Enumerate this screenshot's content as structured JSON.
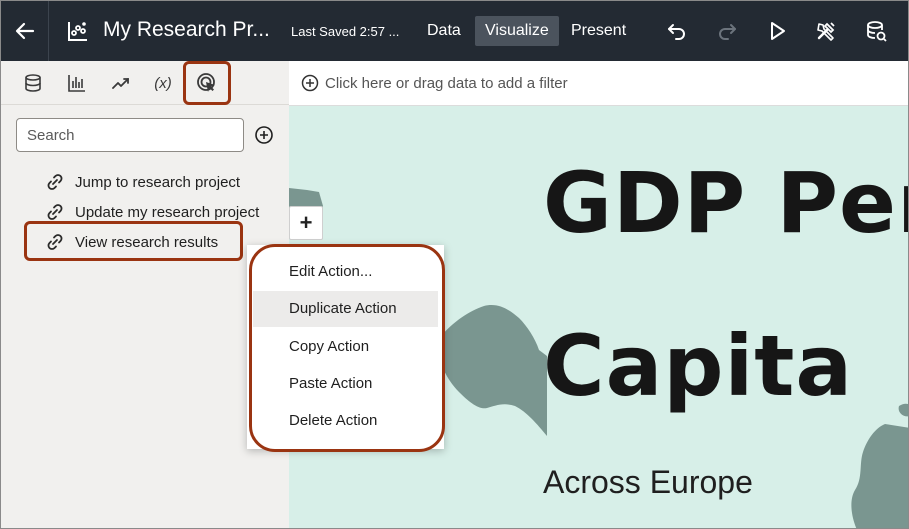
{
  "topbar": {
    "project_title": "My Research Pr...",
    "last_saved": "Last Saved 2:57 ...",
    "tabs": [
      {
        "label": "Data",
        "active": false
      },
      {
        "label": "Visualize",
        "active": true
      },
      {
        "label": "Present",
        "active": false
      }
    ],
    "icons": [
      "back-arrow-icon",
      "project-chart-icon",
      "undo-icon",
      "redo-icon",
      "play-icon",
      "tools-icon",
      "data-refresh-icon"
    ]
  },
  "left_panel": {
    "tab_icons": [
      "database-icon",
      "bar-chart-icon",
      "trend-line-icon",
      "calculation-icon",
      "action-cursor-icon"
    ],
    "calculation_label": "(x)",
    "search_placeholder": "Search",
    "actions": [
      {
        "label": "Jump to research project"
      },
      {
        "label": "Update my research project"
      },
      {
        "label": "View research results"
      }
    ]
  },
  "filter_bar": {
    "placeholder": "Click here or drag data to add a filter"
  },
  "canvas": {
    "zoom_in_label": "+",
    "title_line1": "GDP Per",
    "title_line2": "Capita",
    "subtitle": "Across Europe"
  },
  "context_menu": {
    "items": [
      {
        "label": "Edit Action..."
      },
      {
        "label": "Duplicate Action"
      },
      {
        "label": "Copy Action"
      },
      {
        "label": "Paste Action"
      },
      {
        "label": "Delete Action"
      }
    ]
  },
  "colors": {
    "topbar_bg": "#232a33",
    "active_tab_bg": "#4b535d",
    "panel_bg": "#f1f0ee",
    "canvas_bg": "#d7efe8",
    "map_land": "#7a9690",
    "callout_border": "#9a3411"
  }
}
